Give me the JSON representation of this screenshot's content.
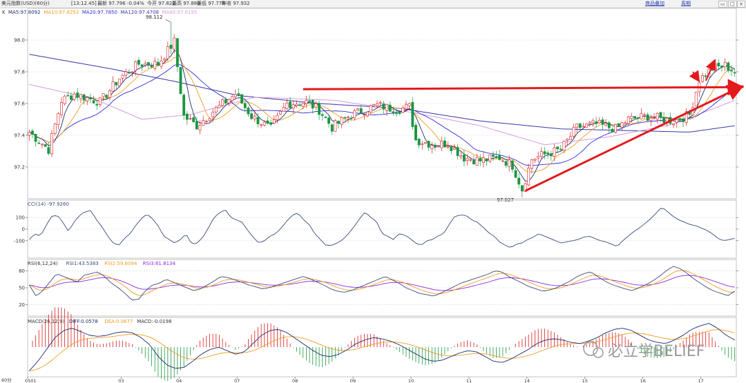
{
  "toolbar": {
    "instrument": "美元指数(USD)(60分)",
    "time": "[13:12.45]",
    "latest": "最新 97.796 -0.04%",
    "open": "今开 97.822",
    "high": "最高 97.880",
    "low": "最低 97.778",
    "prev_close": "昨收 97.932",
    "link1": "商品叠加",
    "link2": "周期"
  },
  "colors": {
    "up": "#d7191c",
    "down": "#1a9641",
    "ma5": "#202b73",
    "ma10": "#f29b1f",
    "ma20": "#2b2bd6",
    "ma120": "#3636a8",
    "ma60": "#d59be0",
    "arrow": "#e3191c",
    "grid": "#d0d0d0",
    "text": "#333333"
  },
  "chart_data": [
    {
      "type": "candlestick",
      "panel": "K",
      "legend": [
        {
          "name": "MA5",
          "text": "MA5:97.8092",
          "color": "#202b73"
        },
        {
          "name": "MA10",
          "text": "MA10:97.8252",
          "color": "#f29b1f"
        },
        {
          "name": "MA20",
          "text": "MA20:97.7850",
          "color": "#2b2bd6"
        },
        {
          "name": "MA120",
          "text": "MA120:97.4708",
          "color": "#3636a8"
        },
        {
          "name": "MA60",
          "text": "MA60:97.6195",
          "color": "#d59be0"
        }
      ],
      "y_ticks": [
        "98.0",
        "97.8",
        "97.6",
        "97.4",
        "97.2"
      ],
      "ylim": [
        97.0,
        98.2
      ],
      "x_ticks": [
        "0501",
        "03",
        "04",
        "07",
        "08",
        "09",
        "10",
        "11",
        "14",
        "15",
        "16",
        "17"
      ],
      "x_tick_bars": [
        0,
        29,
        47,
        65,
        83,
        101,
        119,
        137,
        155,
        173,
        191,
        209
      ],
      "bar_count": 220,
      "anchors": [
        [
          0,
          97.42
        ],
        [
          6,
          97.31
        ],
        [
          10,
          97.62
        ],
        [
          14,
          97.66
        ],
        [
          22,
          97.61
        ],
        [
          28,
          97.76
        ],
        [
          34,
          97.85
        ],
        [
          40,
          97.85
        ],
        [
          45,
          97.99
        ],
        [
          48,
          97.52
        ],
        [
          52,
          97.46
        ],
        [
          57,
          97.55
        ],
        [
          64,
          97.66
        ],
        [
          69,
          97.52
        ],
        [
          75,
          97.44
        ],
        [
          80,
          97.6
        ],
        [
          86,
          97.61
        ],
        [
          90,
          97.56
        ],
        [
          94,
          97.45
        ],
        [
          100,
          97.53
        ],
        [
          108,
          97.59
        ],
        [
          114,
          97.56
        ],
        [
          118,
          97.58
        ],
        [
          120,
          97.37
        ],
        [
          126,
          97.34
        ],
        [
          130,
          97.35
        ],
        [
          135,
          97.26
        ],
        [
          140,
          97.24
        ],
        [
          146,
          97.26
        ],
        [
          150,
          97.21
        ],
        [
          153,
          97.06
        ],
        [
          156,
          97.25
        ],
        [
          160,
          97.28
        ],
        [
          165,
          97.31
        ],
        [
          170,
          97.45
        ],
        [
          176,
          97.47
        ],
        [
          182,
          97.44
        ],
        [
          186,
          97.5
        ],
        [
          192,
          97.52
        ],
        [
          200,
          97.49
        ],
        [
          205,
          97.53
        ],
        [
          208,
          97.75
        ],
        [
          212,
          97.82
        ],
        [
          216,
          97.84
        ],
        [
          219,
          97.8
        ]
      ],
      "ma_curves": {
        "MA60": [
          [
            0,
            97.72
          ],
          [
            20,
            97.63
          ],
          [
            35,
            97.5
          ],
          [
            50,
            97.53
          ],
          [
            70,
            97.64
          ],
          [
            95,
            97.62
          ],
          [
            120,
            97.54
          ],
          [
            140,
            97.46
          ],
          [
            160,
            97.34
          ],
          [
            180,
            97.39
          ],
          [
            200,
            97.47
          ],
          [
            219,
            97.62
          ]
        ],
        "MA120": [
          [
            0,
            97.91
          ],
          [
            25,
            97.82
          ],
          [
            45,
            97.74
          ],
          [
            65,
            97.65
          ],
          [
            90,
            97.6
          ],
          [
            115,
            97.57
          ],
          [
            140,
            97.49
          ],
          [
            165,
            97.44
          ],
          [
            185,
            97.43
          ],
          [
            205,
            97.42
          ],
          [
            219,
            97.46
          ]
        ]
      },
      "annotations": [
        {
          "text": "98.112",
          "bar": 44,
          "value": 98.112
        },
        {
          "text": "97.027",
          "bar": 153,
          "value": 97.027
        }
      ],
      "trendlines": [
        {
          "from": [
            85,
            97.69
          ],
          "to": [
            219,
            97.69
          ]
        },
        {
          "from": [
            154,
            97.05
          ],
          "to": [
            219,
            97.69
          ]
        }
      ]
    },
    {
      "type": "line",
      "panel": "CCI",
      "legend": [
        {
          "name": "CCI(14)",
          "text": "CCI(14) -97.9260",
          "color": "#3a4a7a"
        }
      ],
      "y_ticks": [
        "100",
        "0",
        "-100"
      ],
      "ylim": [
        -250,
        250
      ],
      "values": [
        -90,
        -40,
        -60,
        30,
        110,
        120,
        60,
        -20,
        60,
        120,
        150,
        160,
        80,
        20,
        -60,
        -120,
        -140,
        -80,
        -40,
        30,
        90,
        130,
        90,
        30,
        -60,
        -90,
        -120,
        -90,
        -40,
        -130,
        -120,
        -70,
        10,
        100,
        140,
        170,
        100,
        80,
        60,
        -10,
        -70,
        -120,
        -100,
        -60,
        -40,
        10,
        70,
        120,
        140,
        80,
        40,
        -40,
        -90,
        -140,
        -140,
        -120,
        -90,
        -40,
        20,
        90,
        150,
        100,
        70,
        -40,
        -60,
        -90,
        -40,
        -50,
        -80,
        -120,
        -140,
        -100,
        -90,
        -60,
        -40,
        40,
        110,
        120,
        120,
        80,
        60,
        20,
        -30,
        -60,
        -110,
        -140,
        -160,
        -130,
        -120,
        -90,
        -70,
        -40,
        -60,
        -80,
        -100,
        -120,
        -110,
        -100,
        -90,
        -70,
        -60,
        -80,
        -100,
        -110,
        -130,
        -150,
        -100,
        -60,
        -20,
        10,
        50,
        90,
        140,
        190,
        150,
        110,
        80,
        60,
        40,
        30,
        10,
        -10,
        -40,
        -80,
        -100,
        -90,
        -80
      ]
    },
    {
      "type": "line",
      "panel": "RSI",
      "legend": [
        {
          "name": "RSI1",
          "text": "RSI1:43.5383",
          "color": "#3a4a7a"
        },
        {
          "name": "RSI2",
          "text": "RSI2:59.6094",
          "color": "#f29b1f"
        },
        {
          "name": "RSI3",
          "text": "RSI3:61.8134",
          "color": "#8a2be2"
        }
      ],
      "prefix": "RSI(6,12,24)",
      "y_ticks": [
        "80",
        "50",
        "20"
      ],
      "ylim": [
        0,
        100
      ],
      "rsi1_values": [
        55,
        35,
        45,
        60,
        75,
        70,
        65,
        60,
        72,
        75,
        78,
        70,
        58,
        50,
        40,
        28,
        30,
        45,
        55,
        58,
        65,
        60,
        55,
        50,
        45,
        48,
        55,
        62,
        70,
        68,
        64,
        60,
        55,
        52,
        48,
        50,
        54,
        58,
        62,
        66,
        70,
        66,
        60,
        55,
        48,
        44,
        42,
        45,
        50,
        55,
        60,
        65,
        70,
        64,
        58,
        50,
        45,
        40,
        38,
        35,
        40,
        46,
        52,
        58,
        62,
        66,
        70,
        74,
        80,
        78,
        70,
        64,
        58,
        52,
        48,
        44,
        46,
        50,
        56,
        62,
        70,
        75,
        78,
        70,
        62,
        56,
        52,
        48,
        45,
        50,
        55,
        62,
        70,
        80,
        88,
        84,
        76,
        66,
        58,
        50,
        44,
        40,
        36,
        44
      ]
    },
    {
      "type": "bar+line",
      "panel": "MACD",
      "legend": [
        {
          "name": "DIFF",
          "text": "DIFF:0.0578",
          "color": "#1a2a6a"
        },
        {
          "name": "DEA",
          "text": "DEA:0.0677",
          "color": "#f29b1f"
        },
        {
          "name": "MACD",
          "text": "MACD:-0.0198",
          "color": "#333333"
        }
      ],
      "prefix": "MACD(26,12,9)",
      "ylim": [
        -0.25,
        0.25
      ],
      "diff_values": [
        -0.2,
        -0.12,
        -0.02,
        0.08,
        0.14,
        0.16,
        0.13,
        0.1,
        0.09,
        0.1,
        0.12,
        0.13,
        0.12,
        0.08,
        0.02,
        -0.08,
        -0.15,
        -0.18,
        -0.17,
        -0.12,
        -0.06,
        -0.02,
        0.0,
        -0.03,
        -0.06,
        -0.04,
        0.03,
        0.1,
        0.14,
        0.15,
        0.12,
        0.07,
        0.02,
        -0.03,
        -0.07,
        -0.08,
        -0.06,
        -0.02,
        0.03,
        0.06,
        0.08,
        0.07,
        0.05,
        0.02,
        -0.02,
        -0.06,
        -0.1,
        -0.12,
        -0.11,
        -0.08,
        -0.05,
        -0.03,
        -0.04,
        -0.08,
        -0.12,
        -0.13,
        -0.1,
        -0.06,
        -0.02,
        0.03,
        0.06,
        0.07,
        0.06,
        0.04,
        0.03,
        0.05,
        0.08,
        0.12,
        0.15,
        0.16,
        0.14,
        0.1,
        0.06,
        0.04,
        0.03,
        0.06,
        0.1,
        0.15,
        0.18,
        0.2,
        0.16,
        0.1,
        0.06
      ]
    }
  ],
  "bottom_axis": {
    "period": "60分",
    "labels": [
      "0501",
      "03",
      "04",
      "07",
      "08",
      "09",
      "10",
      "11",
      "14",
      "15",
      "16",
      "17"
    ]
  },
  "watermark": "必立学BELIEF"
}
